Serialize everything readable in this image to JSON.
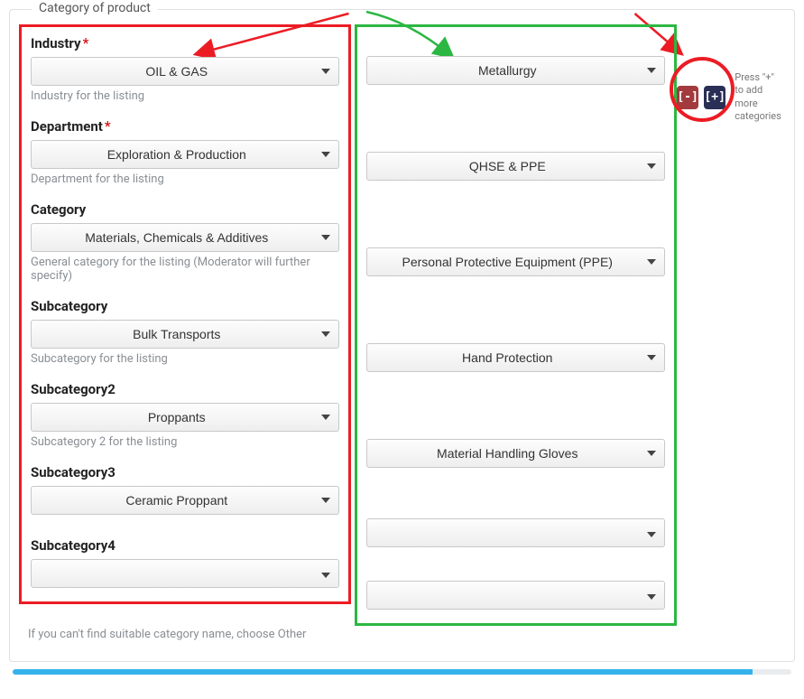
{
  "panel": {
    "title": "Category of product"
  },
  "labels": {
    "industry": "Industry",
    "department": "Department",
    "category": "Category",
    "subcategory": "Subcategory",
    "subcategory2": "Subcategory2",
    "subcategory3": "Subcategory3",
    "subcategory4": "Subcategory4",
    "required_marker": "*"
  },
  "hints": {
    "industry": "Industry for the listing",
    "department": "Department for the listing",
    "category": "General category for the listing (Moderator will further specify)",
    "subcategory": "Subcategory for the listing",
    "subcategory2": "Subcategory 2 for the listing",
    "footer": "If you can't find suitable category name, choose Other"
  },
  "colA": {
    "industry": "OIL & GAS",
    "department": "Exploration & Production",
    "category": "Materials, Chemicals & Additives",
    "subcategory": "Bulk Transports",
    "subcategory2": "Proppants",
    "subcategory3": "Ceramic Proppant",
    "subcategory4": ""
  },
  "colB": {
    "industry": "Metallurgy",
    "department": "QHSE & PPE",
    "category": "Personal Protective Equipment (PPE)",
    "subcategory": "Hand Protection",
    "subcategory2": "Material Handling Gloves",
    "subcategory3": "",
    "subcategory4": ""
  },
  "actions": {
    "remove_label": "[-]",
    "add_label": "[+]",
    "side_hint": "Press \"+\" to add more categories"
  },
  "colors": {
    "annot_red": "#ec1c24",
    "annot_green": "#2cb742",
    "btn_remove": "#a23a3e",
    "btn_add": "#2a2f55",
    "progress": "#34b3eb"
  }
}
